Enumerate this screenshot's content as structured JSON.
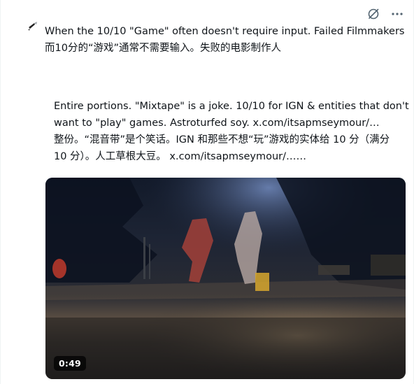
{
  "header": {
    "actions": [
      {
        "icon": "grok-icon"
      },
      {
        "icon": "more-horizontal-icon"
      }
    ]
  },
  "post": {
    "line1": "When the 10/10 \"Game\" often doesn't require input. Failed Filmmakers",
    "line2": "而10分的“游戏”通常不需要输入。失败的电影制作人"
  },
  "quote": {
    "line1": "Entire portions. \"Mixtape\" is a joke. 10/10 for IGN & entities that don't",
    "line2": "want to \"play\" games. Astroturfed soy.  x.com/itsapmseymour/…",
    "line3": "整份。“混音带”是个笑话。IGN 和那些不想“玩”游戏的实体给 10 分（满分",
    "line4": "10 分）。人工草根大豆。 x.com/itsapmseymour/……"
  },
  "video": {
    "duration": "0:49"
  }
}
